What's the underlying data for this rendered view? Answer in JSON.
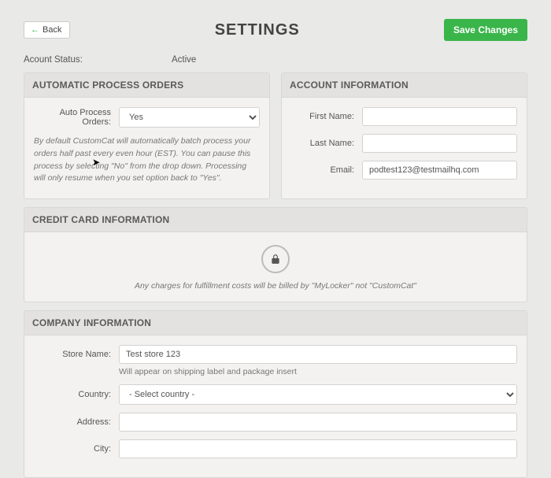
{
  "header": {
    "back_label": "Back",
    "title": "SETTINGS",
    "save_label": "Save Changes"
  },
  "status": {
    "label": "Acount Status:",
    "value": "Active"
  },
  "auto_process": {
    "panel_title": "AUTOMATIC PROCESS ORDERS",
    "label": "Auto Process Orders:",
    "value": "Yes",
    "help": "By default CustomCat will automatically batch process your orders half past every even hour (EST). You can pause this process by selecting \"No\" from the drop down. Processing will only resume when you set option back to \"Yes\"."
  },
  "account_info": {
    "panel_title": "ACCOUNT INFORMATION",
    "first_name_label": "First Name:",
    "first_name": "",
    "last_name_label": "Last Name:",
    "last_name": "",
    "email_label": "Email:",
    "email": "podtest123@testmailhq.com"
  },
  "credit_card": {
    "panel_title": "CREDIT CARD INFORMATION",
    "note": "Any charges for fulfillment costs will be billed by \"MyLocker\" not \"CustomCat\""
  },
  "company": {
    "panel_title": "COMPANY INFORMATION",
    "store_name_label": "Store Name:",
    "store_name": "Test store 123",
    "store_name_help": "Will appear on shipping label and package insert",
    "country_label": "Country:",
    "country_value": "- Select country -",
    "address_label": "Address:",
    "address": "",
    "city_label": "City:",
    "city": ""
  }
}
